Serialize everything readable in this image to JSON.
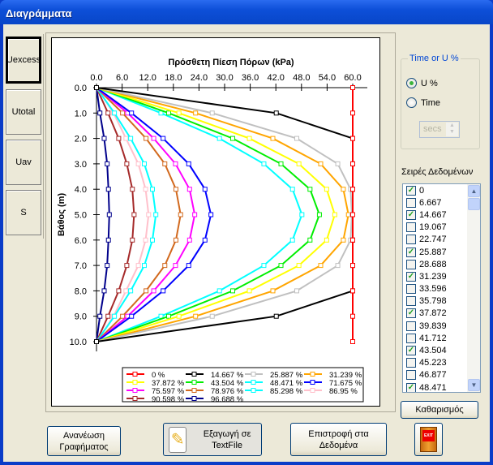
{
  "window": {
    "title": "Διαγράμματα"
  },
  "tabs": [
    {
      "label": "Uexcess",
      "selected": true
    },
    {
      "label": "Utotal"
    },
    {
      "label": "Uav"
    },
    {
      "label": "S"
    }
  ],
  "options": {
    "group_label": "Time or U %",
    "radio_u": "U %",
    "radio_time": "Time",
    "selected": "U %",
    "unit_value": "secs"
  },
  "series_list": {
    "label": "Σειρές Δεδομένων",
    "items": [
      {
        "label": "0",
        "checked": true
      },
      {
        "label": "6.667",
        "checked": false
      },
      {
        "label": "14.667",
        "checked": true
      },
      {
        "label": "19.067",
        "checked": false
      },
      {
        "label": "22.747",
        "checked": false
      },
      {
        "label": "25.887",
        "checked": true
      },
      {
        "label": "28.688",
        "checked": false
      },
      {
        "label": "31.239",
        "checked": true
      },
      {
        "label": "33.596",
        "checked": false
      },
      {
        "label": "35.798",
        "checked": false
      },
      {
        "label": "37.872",
        "checked": true
      },
      {
        "label": "39.839",
        "checked": false
      },
      {
        "label": "41.712",
        "checked": false
      },
      {
        "label": "43.504",
        "checked": true
      },
      {
        "label": "45.223",
        "checked": false
      },
      {
        "label": "46.877",
        "checked": false
      },
      {
        "label": "48.471",
        "checked": true
      }
    ]
  },
  "buttons": {
    "clear": "Καθαρισμός",
    "refresh": "Ανανέωση Γραφήματος",
    "export": "Εξαγωγή σε TextFile",
    "back": "Επιστροφή στα Δεδομένα",
    "exit_sign": "EXIT"
  },
  "chart_data": {
    "type": "line",
    "title": "Πρόσθετη Πίεση Πόρων (kPa)",
    "xlabel": "Πρόσθετη Πίεση Πόρων (kPa)",
    "ylabel": "Βάθος (m)",
    "xlim": [
      0,
      60
    ],
    "ylim": [
      10,
      0
    ],
    "x_ticks": [
      "0.0",
      "6.0",
      "12.0",
      "18.0",
      "24.0",
      "30.0",
      "36.0",
      "42.0",
      "48.0",
      "54.0",
      "60.0"
    ],
    "y_ticks": [
      "0.0",
      "1.0",
      "2.0",
      "3.0",
      "4.0",
      "5.0",
      "6.0",
      "7.0",
      "8.0",
      "9.0",
      "10.0"
    ],
    "x_axis_position": "top",
    "grid": false,
    "legend_position": "bottom",
    "depth": [
      0,
      1,
      2,
      3,
      4,
      5,
      6,
      7,
      8,
      9,
      10
    ],
    "series": [
      {
        "name": "0 %",
        "color": "#ff0000",
        "values": [
          60,
          60,
          60,
          60,
          60,
          60,
          60,
          60,
          60,
          60,
          60
        ]
      },
      {
        "name": "14.667 %",
        "color": "#000000",
        "values": [
          0,
          42.1,
          60,
          60,
          60,
          60,
          60,
          60,
          60,
          42.1,
          0
        ]
      },
      {
        "name": "25.887 %",
        "color": "#c0c0c0",
        "values": [
          0,
          27.1,
          46.9,
          56.5,
          59.5,
          59.8,
          59.5,
          56.5,
          46.9,
          27.1,
          0
        ]
      },
      {
        "name": "31.239 %",
        "color": "#ffa500",
        "values": [
          0,
          23.2,
          41.3,
          52.5,
          57.8,
          59.0,
          57.8,
          52.5,
          41.3,
          23.2,
          0
        ]
      },
      {
        "name": "37.872 %",
        "color": "#ffff00",
        "values": [
          0,
          19.3,
          35.8,
          47.4,
          53.9,
          55.8,
          53.9,
          47.4,
          35.8,
          19.3,
          0
        ]
      },
      {
        "name": "43.504 %",
        "color": "#00ee00",
        "values": [
          0,
          16.9,
          31.9,
          43.2,
          50.0,
          52.2,
          50.0,
          43.2,
          31.9,
          16.9,
          0
        ]
      },
      {
        "name": "48.471 %",
        "color": "#00ffff",
        "values": [
          0,
          15.1,
          28.8,
          39.2,
          45.9,
          48.1,
          45.9,
          39.2,
          28.8,
          15.1,
          0
        ]
      },
      {
        "name": "71.675 %",
        "color": "#0000ff",
        "values": [
          0,
          8.2,
          15.6,
          21.6,
          25.4,
          26.8,
          25.4,
          21.6,
          15.6,
          8.2,
          0
        ]
      },
      {
        "name": "75.597 %",
        "color": "#ff00ff",
        "values": [
          0,
          7.3,
          13.4,
          18.5,
          21.8,
          23.0,
          21.8,
          18.5,
          13.4,
          7.3,
          0
        ]
      },
      {
        "name": "78.976 %",
        "color": "#d2691e",
        "values": [
          0,
          6.1,
          11.6,
          16.0,
          18.6,
          19.7,
          18.6,
          16.0,
          11.6,
          6.1,
          0
        ]
      },
      {
        "name": "85.298 %",
        "color": "#00ffff",
        "values": [
          0,
          4.2,
          8.0,
          11.2,
          13.1,
          13.9,
          13.1,
          11.2,
          8.0,
          4.2,
          0
        ]
      },
      {
        "name": "86.95 %",
        "color": "#ffc0cb",
        "values": [
          0,
          4.0,
          6.9,
          9.8,
          11.5,
          12.2,
          11.5,
          9.8,
          6.9,
          4.0,
          0
        ]
      },
      {
        "name": "90.598 %",
        "color": "#a52a2a",
        "values": [
          0,
          2.7,
          5.2,
          7.1,
          8.4,
          8.8,
          8.4,
          7.1,
          5.2,
          2.7,
          0
        ]
      },
      {
        "name": "96.688 %",
        "color": "#00008b",
        "values": [
          0,
          0.8,
          1.8,
          2.5,
          2.8,
          3.0,
          2.8,
          2.5,
          1.8,
          0.8,
          0
        ]
      }
    ]
  }
}
